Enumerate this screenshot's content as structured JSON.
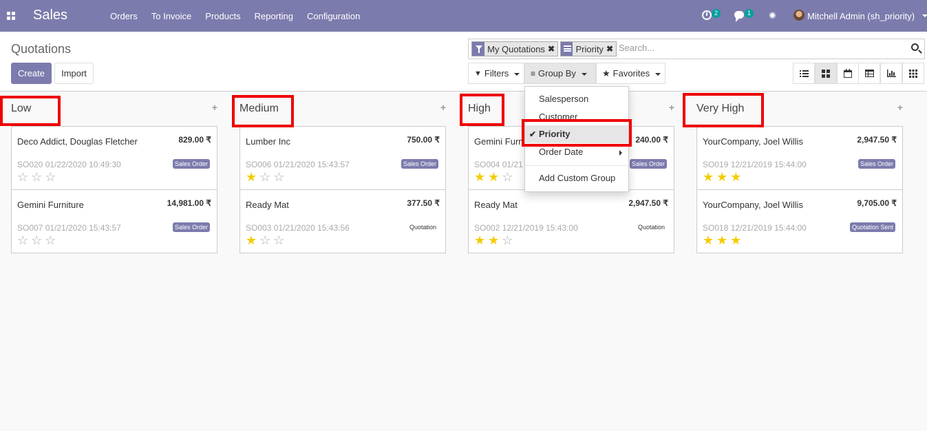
{
  "app": {
    "title": "Sales"
  },
  "menu": [
    "Orders",
    "To Invoice",
    "Products",
    "Reporting",
    "Configuration"
  ],
  "systray": {
    "activity_count": "2",
    "message_count": "1",
    "user": "Mitchell Admin (sh_priority)"
  },
  "breadcrumb": "Quotations",
  "buttons": {
    "create": "Create",
    "import": "Import"
  },
  "search": {
    "facets": [
      {
        "label": "My Quotations",
        "icon": "filter-icon"
      },
      {
        "label": "Priority",
        "icon": "group-by-icon"
      }
    ],
    "placeholder": "Search..."
  },
  "filters": {
    "filters_label": "Filters",
    "groupby_label": "Group By",
    "favorites_label": "Favorites"
  },
  "views": [
    "list-view-icon",
    "kanban-view-icon",
    "calendar-view-icon",
    "pivot-view-icon",
    "graph-view-icon",
    "grid-view-icon"
  ],
  "groupby_menu": {
    "items": [
      "Salesperson",
      "Customer",
      "Priority",
      "Order Date"
    ],
    "selected": "Priority",
    "custom": "Add Custom Group"
  },
  "columns": [
    {
      "title": "Low",
      "cards": [
        {
          "name": "Deco Addict, Douglas Fletcher",
          "amount": "829.00 ₹",
          "ref": "SO020 01/22/2020 10:49:30",
          "state": "Sales Order",
          "stars": 0
        },
        {
          "name": "Gemini Furniture",
          "amount": "14,981.00 ₹",
          "ref": "SO007 01/21/2020 15:43:57",
          "state": "Sales Order",
          "stars": 0
        }
      ]
    },
    {
      "title": "Medium",
      "cards": [
        {
          "name": "Lumber Inc",
          "amount": "750.00 ₹",
          "ref": "SO006 01/21/2020 15:43:57",
          "state": "Sales Order",
          "stars": 1
        },
        {
          "name": "Ready Mat",
          "amount": "377.50 ₹",
          "ref": "SO003 01/21/2020 15:43:56",
          "state": "Quotation",
          "stars": 1
        }
      ]
    },
    {
      "title": "High",
      "cards": [
        {
          "name": "Gemini Furni",
          "amount": "240.00 ₹",
          "ref": "SO004 01/21",
          "state": "Sales Order",
          "stars": 2
        },
        {
          "name": "Ready Mat",
          "amount": "2,947.50 ₹",
          "ref": "SO002 12/21/2019 15:43:00",
          "state": "Quotation",
          "stars": 2
        }
      ]
    },
    {
      "title": "Very High",
      "cards": [
        {
          "name": "YourCompany, Joel Willis",
          "amount": "2,947.50 ₹",
          "ref": "SO019 12/21/2019 15:44:00",
          "state": "Sales Order",
          "stars": 3
        },
        {
          "name": "YourCompany, Joel Willis",
          "amount": "9,705.00 ₹",
          "ref": "SO018 12/21/2019 15:44:00",
          "state": "Quotation Sent",
          "stars": 3
        }
      ]
    }
  ],
  "colors": {
    "brand": "#7c7bad",
    "highlight": "#e00000",
    "star_on": "#f3cc00"
  }
}
